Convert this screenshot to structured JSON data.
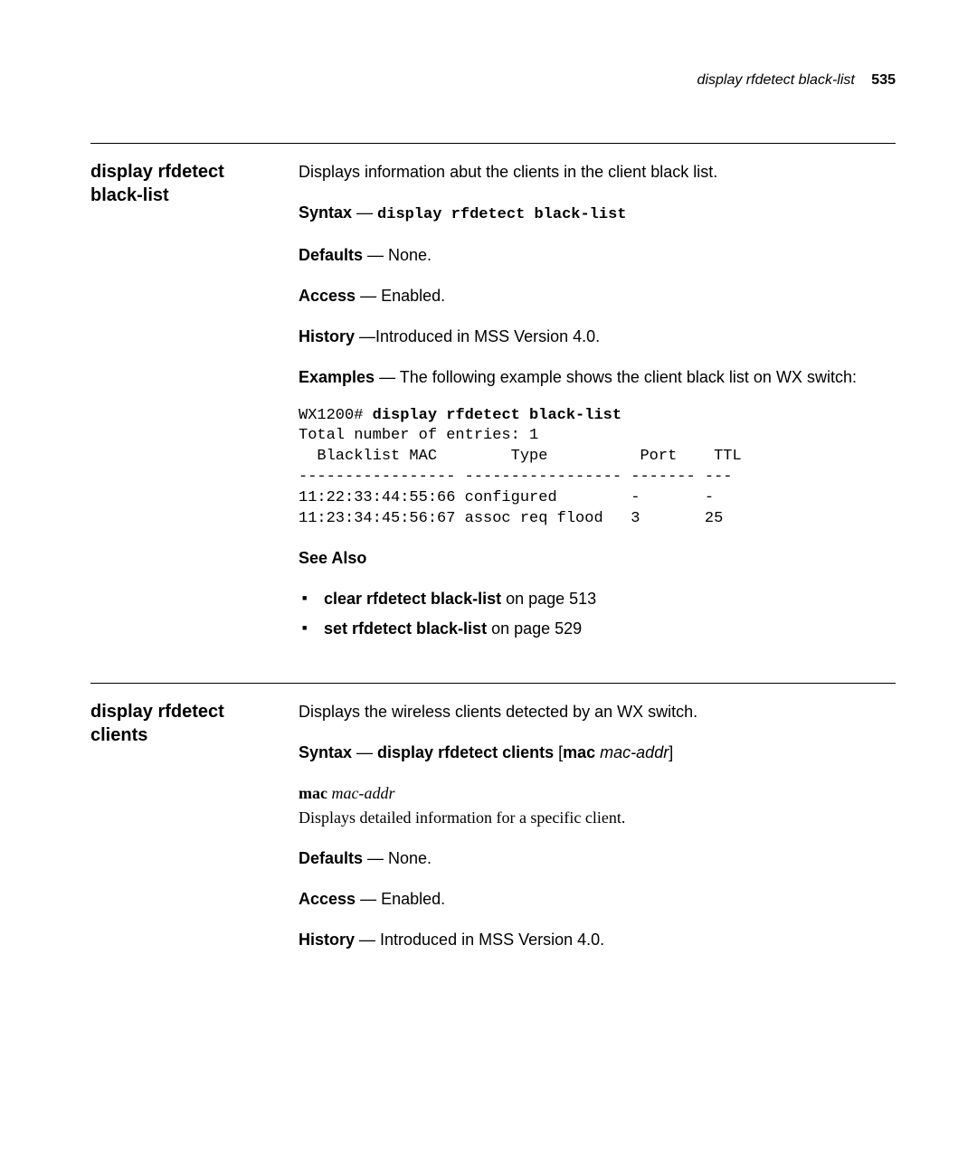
{
  "header": {
    "title": "display rfdetect black-list",
    "pagenum": "535"
  },
  "sections": [
    {
      "heading": "display rfdetect black-list",
      "intro": "Displays information abut the clients in the client black list.",
      "syntax_label": "Syntax",
      "syntax_dash": " — ",
      "syntax_cmd": "display rfdetect black-list",
      "defaults_label": "Defaults",
      "defaults_text": " — None.",
      "access_label": "Access",
      "access_text": " — Enabled.",
      "history_label": "History",
      "history_text": " —Introduced in MSS Version 4.0.",
      "examples_label": "Examples",
      "examples_text": " — The following example shows the client black list on WX switch:",
      "cli_prompt": "WX1200# ",
      "cli_cmd": "display rfdetect black-list",
      "cli_output": "Total number of entries: 1\n  Blacklist MAC        Type          Port    TTL\n----------------- ----------------- ------- ---\n11:22:33:44:55:66 configured        -       -\n11:23:34:45:56:67 assoc req flood   3       25",
      "see_also_label": "See Also",
      "see_also_items": [
        {
          "cmd": "clear rfdetect black-list",
          "suffix": " on page 513"
        },
        {
          "cmd": "set rfdetect black-list",
          "suffix": " on page 529"
        }
      ]
    },
    {
      "heading": "display rfdetect clients",
      "intro": "Displays the wireless clients detected by an WX switch.",
      "syntax_label": "Syntax",
      "syntax_dash": " — ",
      "syntax_cmd_bold": "display rfdetect clients",
      "syntax_cmd_bracket_open": " [",
      "syntax_cmd_bold2": "mac",
      "syntax_cmd_ital": " mac-addr",
      "syntax_cmd_bracket_close": "]",
      "param_bold": "mac",
      "param_ital": " mac-addr",
      "param_desc": "Displays detailed information for a specific client.",
      "defaults_label": "Defaults",
      "defaults_text": " — None.",
      "access_label": "Access",
      "access_text": " — Enabled.",
      "history_label": "History",
      "history_text": " — Introduced in MSS Version 4.0."
    }
  ]
}
